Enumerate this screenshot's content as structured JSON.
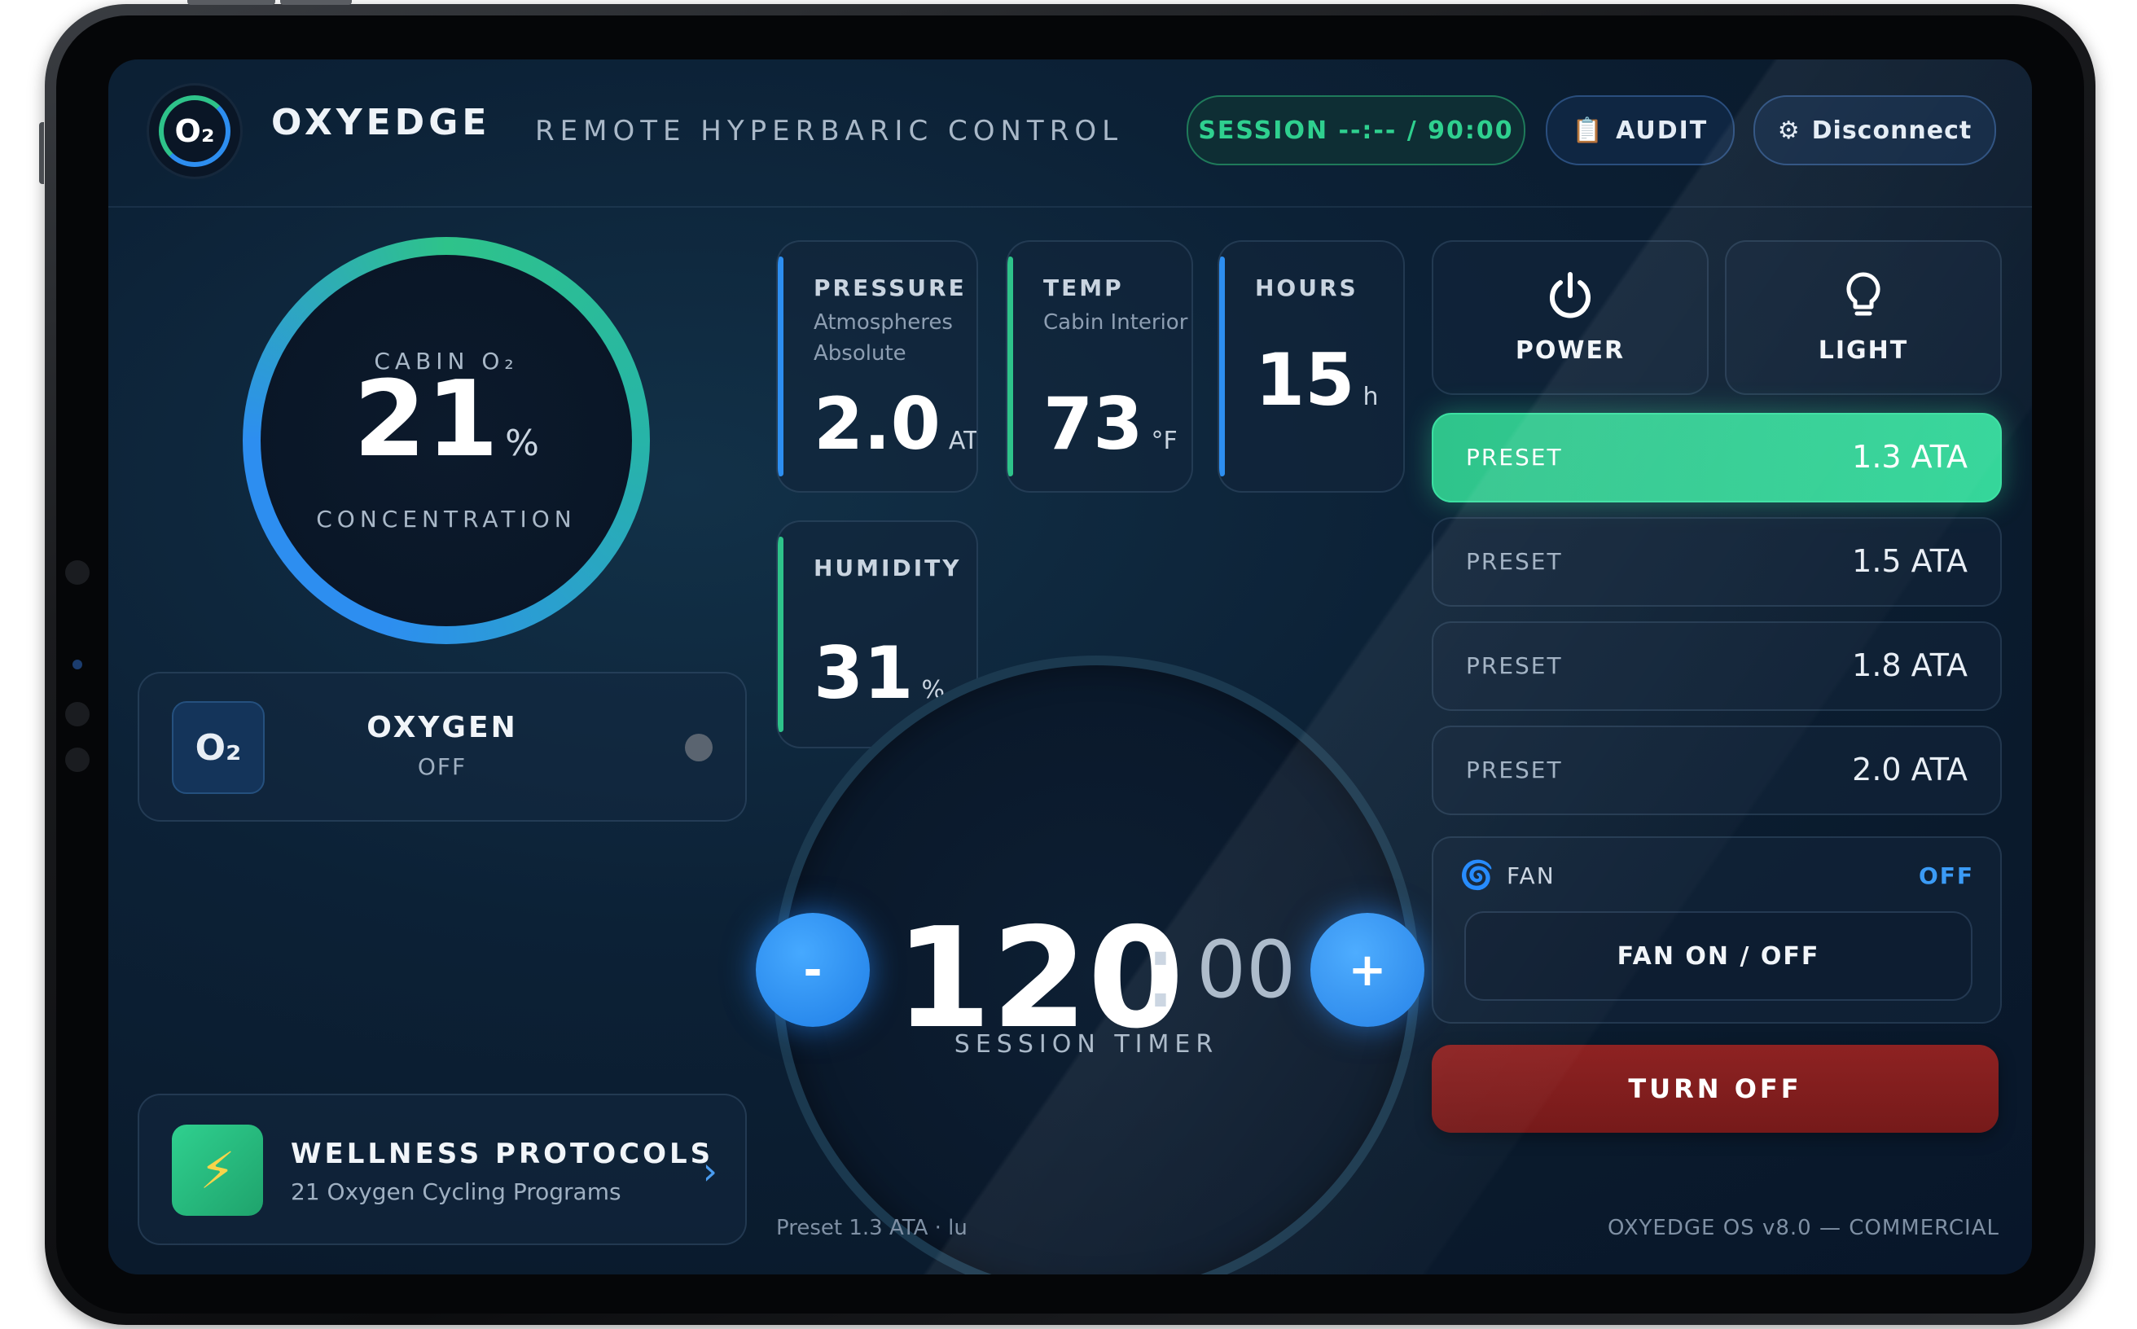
{
  "header": {
    "logo_text": "O₂",
    "brand": "OXYEDGE",
    "subtitle": "REMOTE HYPERBARIC CONTROL",
    "session_label": "SESSION --:-- / 90:00",
    "audit_label": "AUDIT",
    "disconnect_label": "Disconnect"
  },
  "cabin_gauge": {
    "label": "CABIN O₂",
    "value": "21",
    "unit": "%",
    "caption": "CONCENTRATION"
  },
  "oxygen": {
    "badge": "O₂",
    "title": "OXYGEN",
    "state": "OFF"
  },
  "wellness": {
    "title": "WELLNESS PROTOCOLS",
    "subtitle": "21 Oxygen Cycling Programs"
  },
  "stats": {
    "pressure": {
      "name": "PRESSURE",
      "desc": "Atmospheres Absolute",
      "value": "2.0",
      "unit": "ATA"
    },
    "temp": {
      "name": "TEMP",
      "desc": "Cabin Interior",
      "value": "73",
      "unit": "°F"
    },
    "hours": {
      "name": "HOURS",
      "value": "15",
      "unit": "h"
    },
    "humidity": {
      "name": "HUMIDITY",
      "value": "31",
      "unit": "%"
    }
  },
  "timer": {
    "minutes": "120",
    "colon": ":",
    "seconds": "00",
    "label": "SESSION TIMER",
    "minus_label": "-",
    "plus_label": "+"
  },
  "controls": {
    "power_label": "POWER",
    "light_label": "LIGHT"
  },
  "presets": [
    {
      "label": "PRESET",
      "value": "1.3 ATA",
      "active": true
    },
    {
      "label": "PRESET",
      "value": "1.5 ATA",
      "active": false
    },
    {
      "label": "PRESET",
      "value": "1.8 ATA",
      "active": false
    },
    {
      "label": "PRESET",
      "value": "2.0 ATA",
      "active": false
    }
  ],
  "fan": {
    "label": "FAN",
    "state": "OFF",
    "toggle_label": "FAN ON / OFF"
  },
  "turn_off_label": "TURN OFF",
  "footer": {
    "preset_note": "Preset 1.3 ATA · lu",
    "os_version": "OXYEDGE OS v8.0 — COMMERCIAL"
  },
  "colors": {
    "accent_green": "#2fc48b",
    "accent_blue": "#2d8ef0",
    "danger_red": "#8e2222",
    "background": "#0a1a2c"
  },
  "icons": [
    "clipboard-icon",
    "gear-icon",
    "power-icon",
    "lightbulb-icon",
    "lightning-icon",
    "chevron-right-icon",
    "fan-icon",
    "oxygen-icon"
  ]
}
